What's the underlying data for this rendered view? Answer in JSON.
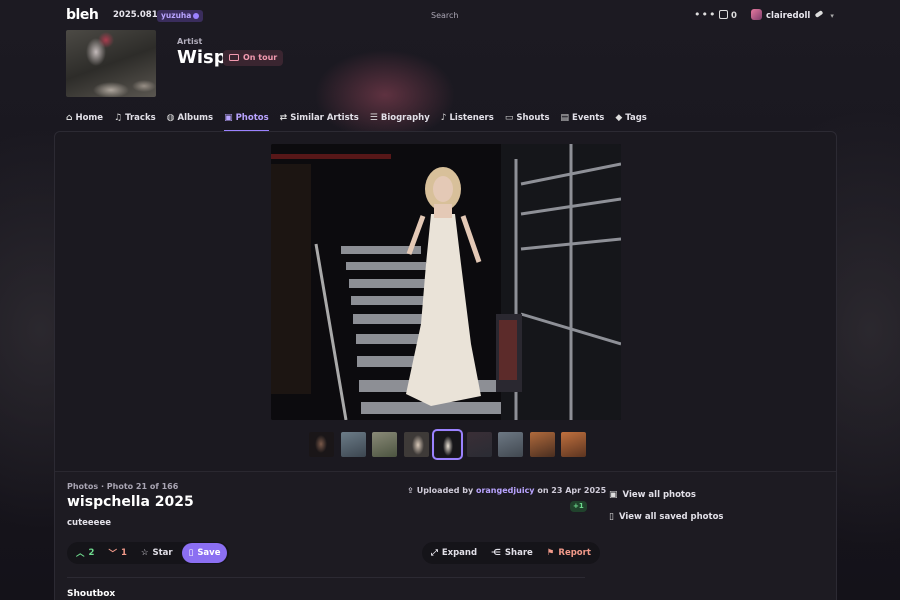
{
  "topbar": {
    "logo": "bleh",
    "version": "2025.0816",
    "username_badge": "yuzuha",
    "search_label": "Search",
    "notification_count": "0",
    "account_name": "clairedoll"
  },
  "artist": {
    "kicker": "Artist",
    "name": "Wisp",
    "tour_badge": "On tour"
  },
  "tabs": [
    {
      "label": "Home",
      "icon": "home-icon",
      "active": false
    },
    {
      "label": "Tracks",
      "icon": "music-note-icon",
      "active": false
    },
    {
      "label": "Albums",
      "icon": "disc-icon",
      "active": false
    },
    {
      "label": "Photos",
      "icon": "photos-icon",
      "active": true
    },
    {
      "label": "Similar Artists",
      "icon": "shuffle-icon",
      "active": false
    },
    {
      "label": "Biography",
      "icon": "text-lines-icon",
      "active": false
    },
    {
      "label": "Listeners",
      "icon": "headphones-icon",
      "active": false
    },
    {
      "label": "Shouts",
      "icon": "chat-bubble-icon",
      "active": false
    },
    {
      "label": "Events",
      "icon": "ticket-icon",
      "active": false
    },
    {
      "label": "Tags",
      "icon": "tag-icon",
      "active": false
    }
  ],
  "photo": {
    "section": "Photos",
    "position": "Photo 21 of 166",
    "title": "wispchella 2025",
    "caption": "cuteeeee",
    "uploaded_prefix": "Uploaded by",
    "uploader": "orangedjuicy",
    "uploaded_on": "on 23 Apr 2025",
    "plus_badge": "+1"
  },
  "actions": {
    "upvotes": "2",
    "downvotes": "1",
    "star": "Star",
    "save": "Save",
    "expand": "Expand",
    "share": "Share",
    "report": "Report"
  },
  "sidebar": {
    "view_all_photos": "View all photos",
    "view_saved_photos": "View all saved photos"
  },
  "shoutbox_title": "Shoutbox",
  "colors": {
    "accent": "#9b82ff",
    "accent_text": "#b9a4ff",
    "upvote": "#6fdc8f",
    "downvote": "#f29a8a",
    "tour_badge": "#f29ab0",
    "background": "#141219",
    "card": "#1d1b22"
  }
}
